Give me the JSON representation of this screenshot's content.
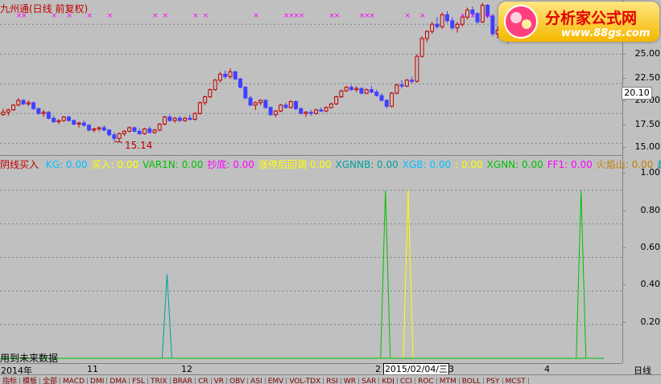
{
  "title": "九州通(日线 前复权)",
  "colors": {
    "up": "#c00000",
    "down": "#4040ff",
    "grid": "#808080",
    "marker": "#ff00ff"
  },
  "price_axis": {
    "ticks": [
      "25.00",
      "22.50",
      "20.00",
      "17.50",
      "15.00"
    ],
    "current": "20.10"
  },
  "low_label": "15.14",
  "indicator_axis": {
    "ticks": [
      "1.00",
      "0.80",
      "0.60",
      "0.40",
      "0.20"
    ]
  },
  "indicator_title": "阴线买入",
  "legend": [
    {
      "label": "KG:",
      "value": "0.00",
      "color": "#00c0ff"
    },
    {
      "label": "买入:",
      "value": "0.00",
      "color": "#ffff00"
    },
    {
      "label": "VAR1N:",
      "value": "0.00",
      "color": "#00c000"
    },
    {
      "label": "抄底:",
      "value": "0.00",
      "color": "#ff00ff"
    },
    {
      "label": "涨停后回调",
      "value": "0.00",
      "color": "#ffff00"
    },
    {
      "label": "XGNNB:",
      "value": "0.00",
      "color": "#00a0a0"
    },
    {
      "label": "XGB:",
      "value": "0.00",
      "color": "#00c0ff"
    },
    {
      "label": ":",
      "value": "0.00",
      "color": "#ffff00"
    },
    {
      "label": "XGNN:",
      "value": "0.00",
      "color": "#00c000"
    },
    {
      "label": "FF1:",
      "value": "0.00",
      "color": "#ff00ff"
    },
    {
      "label": "火焰山:",
      "value": "0.00",
      "color": "#c08000"
    },
    {
      "label": "超",
      "value": "",
      "color": "#00a0a0"
    }
  ],
  "future_note": "用到未来数据",
  "time_axis": {
    "labels": [
      "2014年",
      "11",
      "12",
      "2",
      "3",
      "4"
    ],
    "cursor_date": "2015/02/04/三"
  },
  "period": "日线",
  "watermark": {
    "text": "分析家公式网",
    "url": "www.88gs.com"
  },
  "tabs": [
    "指标",
    "模板",
    "全部",
    "MACD",
    "DMI",
    "DMA",
    "FSL",
    "TRIX",
    "BRAR",
    "CR",
    "VR",
    "OBV",
    "ASI",
    "EMV",
    "VOL-TDX",
    "RSI",
    "WR",
    "SAR",
    "KDJ",
    "CCI",
    "ROC",
    "MTM",
    "BOLL",
    "PSY",
    "MCST"
  ],
  "chart_data": [
    {
      "type": "candlestick",
      "title": "九州通(日线 前复权)",
      "ylim": [
        14.0,
        26.5
      ],
      "yticks": [
        25.0,
        22.5,
        20.0,
        17.5,
        15.0
      ],
      "annotations": [
        {
          "text": "15.14",
          "value": 15.14
        }
      ],
      "current_price": 20.1,
      "ohlc": [
        [
          17.4,
          17.9,
          17.3,
          17.6
        ],
        [
          17.6,
          17.9,
          17.3,
          17.8
        ],
        [
          17.8,
          18.3,
          17.7,
          18.2
        ],
        [
          18.2,
          18.8,
          18.1,
          18.6
        ],
        [
          18.6,
          18.7,
          18.2,
          18.3
        ],
        [
          18.3,
          18.6,
          18.1,
          18.4
        ],
        [
          18.4,
          18.5,
          17.8,
          17.9
        ],
        [
          17.9,
          18.0,
          17.4,
          17.5
        ],
        [
          17.5,
          17.8,
          17.2,
          17.6
        ],
        [
          17.6,
          17.7,
          17.0,
          17.1
        ],
        [
          17.1,
          17.3,
          16.7,
          16.8
        ],
        [
          16.8,
          17.0,
          16.6,
          16.9
        ],
        [
          16.9,
          17.3,
          16.8,
          17.2
        ],
        [
          17.2,
          17.3,
          16.8,
          16.9
        ],
        [
          16.9,
          17.0,
          16.5,
          16.6
        ],
        [
          16.6,
          16.8,
          16.3,
          16.7
        ],
        [
          16.7,
          16.9,
          16.4,
          16.5
        ],
        [
          16.5,
          16.6,
          16.0,
          16.1
        ],
        [
          16.1,
          16.3,
          15.9,
          16.2
        ],
        [
          16.2,
          16.4,
          16.0,
          16.3
        ],
        [
          16.3,
          16.5,
          16.0,
          16.1
        ],
        [
          16.1,
          16.2,
          15.6,
          15.7
        ],
        [
          15.7,
          15.9,
          15.2,
          15.4
        ],
        [
          15.4,
          15.9,
          15.1,
          15.8
        ],
        [
          15.8,
          16.1,
          15.6,
          16.0
        ],
        [
          16.0,
          16.4,
          15.9,
          16.3
        ],
        [
          16.3,
          16.4,
          15.9,
          16.0
        ],
        [
          16.0,
          16.2,
          15.7,
          15.8
        ],
        [
          15.8,
          16.3,
          15.7,
          16.2
        ],
        [
          16.2,
          16.4,
          15.8,
          15.9
        ],
        [
          15.9,
          16.2,
          15.8,
          16.1
        ],
        [
          16.1,
          16.7,
          16.0,
          16.6
        ],
        [
          16.6,
          17.3,
          16.5,
          17.2
        ],
        [
          17.2,
          17.4,
          16.8,
          16.9
        ],
        [
          16.9,
          17.2,
          16.7,
          17.1
        ],
        [
          17.1,
          17.3,
          16.8,
          16.9
        ],
        [
          16.9,
          17.2,
          16.8,
          17.1
        ],
        [
          17.1,
          17.4,
          16.9,
          17.0
        ],
        [
          17.0,
          17.6,
          16.9,
          17.5
        ],
        [
          17.5,
          18.5,
          17.4,
          18.4
        ],
        [
          18.4,
          19.0,
          18.2,
          18.9
        ],
        [
          18.9,
          19.6,
          18.8,
          19.5
        ],
        [
          19.5,
          20.4,
          19.4,
          20.3
        ],
        [
          20.3,
          21.0,
          20.1,
          20.8
        ],
        [
          20.8,
          21.1,
          20.4,
          20.6
        ],
        [
          20.6,
          21.3,
          20.4,
          21.0
        ],
        [
          21.0,
          21.1,
          20.3,
          20.4
        ],
        [
          20.4,
          20.5,
          19.6,
          19.7
        ],
        [
          19.7,
          19.8,
          18.7,
          18.8
        ],
        [
          18.8,
          19.0,
          18.1,
          18.2
        ],
        [
          18.2,
          18.5,
          17.8,
          18.4
        ],
        [
          18.4,
          18.7,
          18.2,
          18.6
        ],
        [
          18.6,
          18.7,
          17.9,
          18.0
        ],
        [
          18.0,
          18.1,
          17.3,
          17.4
        ],
        [
          17.4,
          17.8,
          17.2,
          17.7
        ],
        [
          17.7,
          18.3,
          17.6,
          18.2
        ],
        [
          18.2,
          18.4,
          17.9,
          18.0
        ],
        [
          18.0,
          18.6,
          17.9,
          18.5
        ],
        [
          18.5,
          18.6,
          17.8,
          17.9
        ],
        [
          17.9,
          18.0,
          17.4,
          17.5
        ],
        [
          17.5,
          17.7,
          17.2,
          17.6
        ],
        [
          17.6,
          17.8,
          17.3,
          17.5
        ],
        [
          17.5,
          17.9,
          17.4,
          17.8
        ],
        [
          17.8,
          18.0,
          17.6,
          17.7
        ],
        [
          17.7,
          18.1,
          17.6,
          18.0
        ],
        [
          18.0,
          18.4,
          17.9,
          18.3
        ],
        [
          18.3,
          19.0,
          18.2,
          18.9
        ],
        [
          18.9,
          19.5,
          18.8,
          19.4
        ],
        [
          19.4,
          19.8,
          19.3,
          19.7
        ],
        [
          19.7,
          19.9,
          19.4,
          19.5
        ],
        [
          19.5,
          19.8,
          19.3,
          19.6
        ],
        [
          19.6,
          19.7,
          19.1,
          19.2
        ],
        [
          19.2,
          19.6,
          19.1,
          19.5
        ],
        [
          19.5,
          19.8,
          19.2,
          19.3
        ],
        [
          19.3,
          19.5,
          18.9,
          19.0
        ],
        [
          19.0,
          19.2,
          18.5,
          18.6
        ],
        [
          18.6,
          18.7,
          17.9,
          18.1
        ],
        [
          18.1,
          19.3,
          18.0,
          19.2
        ],
        [
          19.2,
          20.0,
          19.1,
          19.9
        ],
        [
          19.9,
          20.3,
          19.6,
          19.8
        ],
        [
          19.8,
          20.4,
          19.7,
          20.3
        ],
        [
          20.3,
          20.6,
          20.0,
          20.2
        ],
        [
          20.2,
          22.5,
          20.1,
          22.3
        ],
        [
          22.3,
          24.0,
          22.2,
          23.8
        ],
        [
          23.8,
          24.5,
          23.5,
          24.4
        ],
        [
          24.4,
          25.2,
          24.2,
          25.0
        ],
        [
          25.0,
          25.6,
          24.6,
          24.8
        ],
        [
          24.8,
          26.0,
          24.6,
          25.8
        ],
        [
          25.8,
          26.1,
          25.1,
          25.3
        ],
        [
          25.3,
          25.6,
          24.5,
          24.7
        ],
        [
          24.7,
          25.2,
          24.3,
          25.0
        ],
        [
          25.0,
          25.8,
          24.8,
          25.6
        ],
        [
          25.6,
          26.4,
          25.4,
          26.2
        ],
        [
          26.2,
          26.5,
          25.6,
          25.9
        ],
        [
          25.9,
          26.0,
          25.0,
          25.2
        ],
        [
          25.2,
          26.8,
          25.1,
          26.6
        ],
        [
          26.6,
          26.7,
          25.5,
          25.7
        ],
        [
          25.7,
          25.9,
          24.0,
          24.2
        ],
        [
          24.2,
          24.8,
          23.8,
          24.5
        ],
        [
          24.5,
          24.7,
          23.9,
          24.1
        ],
        [
          24.1,
          24.3,
          23.4,
          23.6
        ],
        [
          23.6,
          24.6,
          23.5,
          24.4
        ],
        [
          24.4,
          25.4,
          24.3,
          25.2
        ],
        [
          25.2,
          25.6,
          24.9,
          25.4
        ],
        [
          25.4,
          25.7,
          25.0,
          25.3
        ],
        [
          25.3,
          25.6,
          25.0,
          25.5
        ],
        [
          25.5,
          25.6,
          24.8,
          25.0
        ],
        [
          25.0,
          26.3,
          24.9,
          26.1
        ],
        [
          26.1,
          26.4,
          25.6,
          25.8
        ],
        [
          25.8,
          26.5,
          25.7,
          26.3
        ],
        [
          26.3,
          26.6,
          26.0,
          26.4
        ],
        [
          26.4,
          26.6,
          26.0,
          26.2
        ],
        [
          26.2,
          26.5,
          25.8,
          26.3
        ],
        [
          26.3,
          26.7,
          26.0,
          26.5
        ],
        [
          26.5,
          26.8,
          26.2,
          26.4
        ],
        [
          26.4,
          26.9,
          26.1,
          26.6
        ],
        [
          26.6,
          26.7,
          25.7,
          25.8
        ],
        [
          25.8,
          25.9,
          24.3,
          24.4
        ],
        [
          24.4,
          25.2,
          24.2,
          25.0
        ],
        [
          25.0,
          25.3,
          24.3,
          24.5
        ],
        [
          24.5,
          25.0,
          24.2,
          24.9
        ]
      ],
      "markers_x_indices": [
        3,
        4,
        10,
        13,
        17,
        21,
        30,
        32,
        38,
        40,
        50,
        56,
        57,
        58,
        59,
        65,
        66,
        71,
        72,
        73,
        80,
        83,
        91,
        93,
        96,
        101,
        105,
        110,
        113
      ]
    },
    {
      "type": "line",
      "title": "阴线买入",
      "ylim": [
        0,
        1.1
      ],
      "yticks": [
        1.0,
        0.8,
        0.6,
        0.4,
        0.2
      ],
      "series": [
        {
          "name": "XGNNB",
          "color": "#00a0a0",
          "spikes": [
            {
              "index": 36,
              "value": 0.5
            }
          ]
        },
        {
          "name": "XGNN",
          "color": "#00c000",
          "spikes": [
            {
              "index": 84,
              "value": 1.0
            },
            {
              "index": 127,
              "value": 1.0
            }
          ]
        },
        {
          "name": "",
          "color": "#ffff00",
          "spikes": [
            {
              "index": 89,
              "value": 1.0
            }
          ]
        }
      ]
    }
  ]
}
